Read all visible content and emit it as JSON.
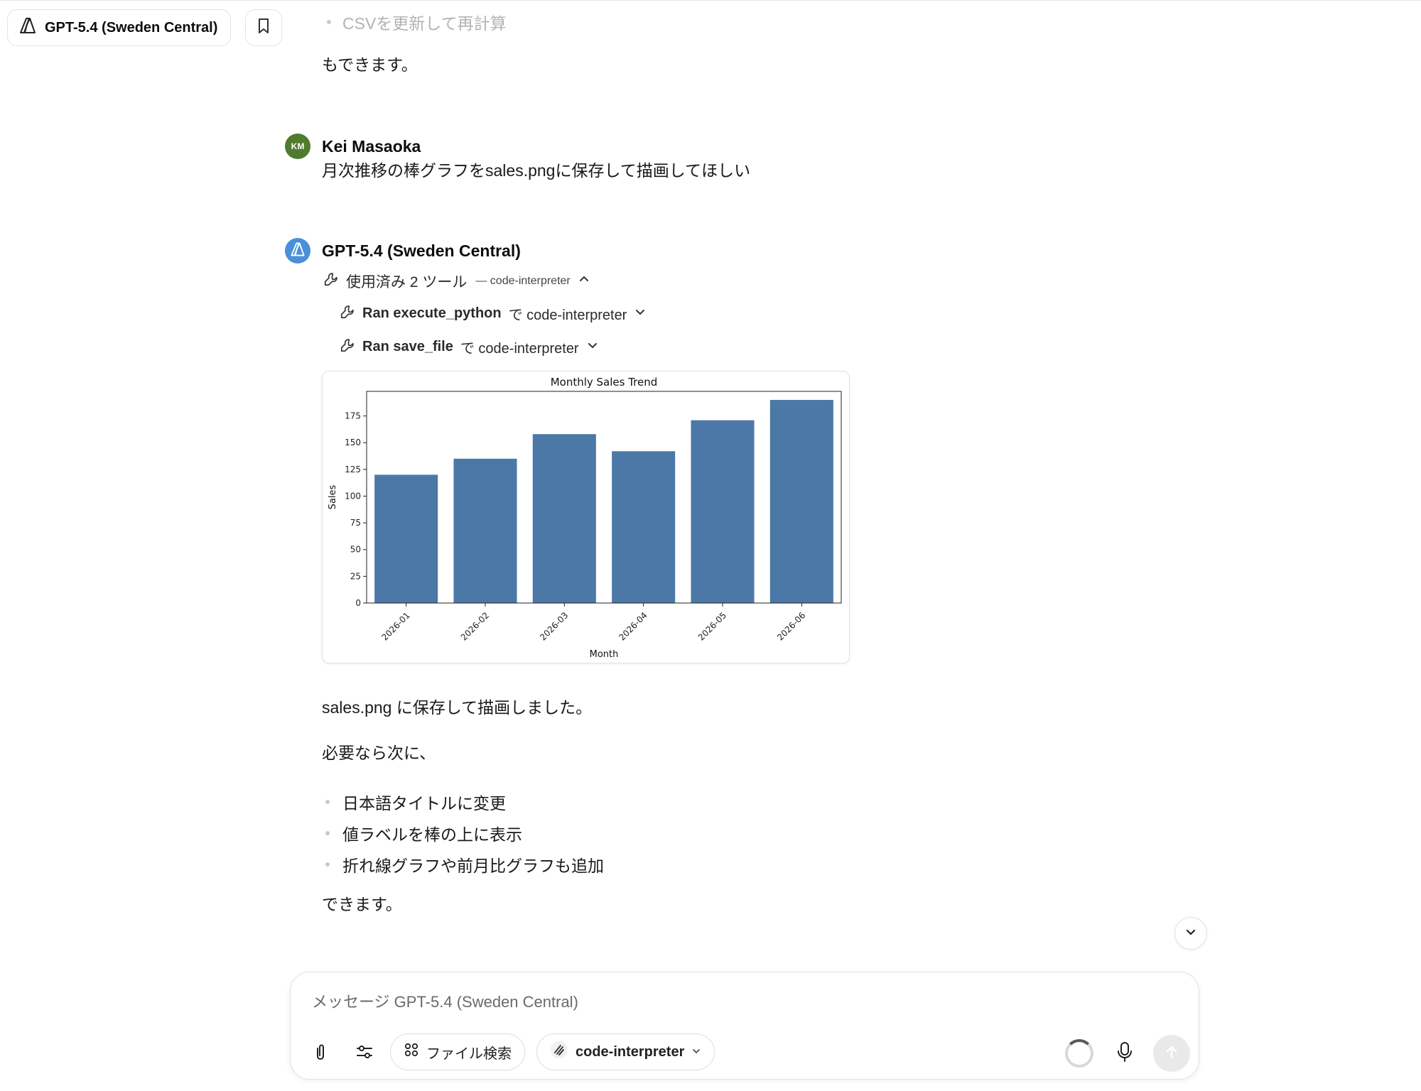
{
  "header": {
    "model_name": "GPT-5.4 (Sweden Central)",
    "model_icon": "azure-logo-icon",
    "bookmark_icon": "bookmark-icon"
  },
  "messages": {
    "prev_bullet": "CSVを更新して再計算",
    "prev_closing": "もできます。",
    "user": {
      "initials": "KM",
      "name": "Kei Masaoka",
      "text": "月次推移の棒グラフをsales.pngに保存して描画してほしい"
    },
    "assistant": {
      "name": "GPT-5.4 (Sweden Central)",
      "tools_summary": "使用済み 2 ツール",
      "tools_summary_sub": "— code-interpreter",
      "tool_calls": [
        {
          "name": "Ran execute_python",
          "via": "で code-interpreter"
        },
        {
          "name": "Ran save_file",
          "via": "で code-interpreter"
        }
      ],
      "saved_text": "sales.png に保存して描画しました。",
      "next_text": "必要なら次に、",
      "suggestions": [
        "日本語タイトルに変更",
        "値ラベルを棒の上に表示",
        "折れ線グラフや前月比グラフも追加"
      ],
      "closing": "できます。"
    }
  },
  "composer": {
    "placeholder": "メッセージ GPT-5.4 (Sweden Central)",
    "file_search_label": "ファイル検索",
    "tool_label": "code-interpreter"
  },
  "chart_data": {
    "type": "bar",
    "title": "Monthly Sales Trend",
    "xlabel": "Month",
    "ylabel": "Sales",
    "categories": [
      "2026-01",
      "2026-02",
      "2026-03",
      "2026-04",
      "2026-05",
      "2026-06"
    ],
    "values": [
      120,
      135,
      158,
      142,
      171,
      190
    ],
    "yticks": [
      0,
      25,
      50,
      75,
      100,
      125,
      150,
      175
    ],
    "ylim": [
      0,
      198
    ],
    "bar_color": "#4c78a8",
    "grid": false
  }
}
